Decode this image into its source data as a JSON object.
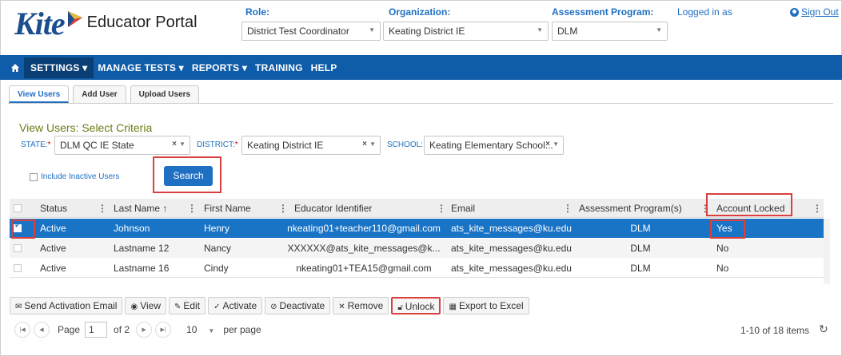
{
  "header": {
    "logo_word": "Kite",
    "portal_name": "Educator Portal",
    "role_label": "Role:",
    "role_value": "District Test Coordinator",
    "org_label": "Organization:",
    "org_value": "Keating District IE",
    "program_label": "Assessment Program:",
    "program_value": "DLM",
    "logged_in": "Logged in as",
    "sign_out": "Sign Out"
  },
  "nav": {
    "items": [
      "SETTINGS ▾",
      "MANAGE TESTS ▾",
      "REPORTS ▾",
      "TRAINING",
      "HELP"
    ]
  },
  "tabs": [
    "View Users",
    "Add User",
    "Upload Users"
  ],
  "criteria": {
    "title": "View Users: Select Criteria",
    "state_label": "STATE:",
    "state_value": "DLM QC IE State",
    "district_label": "DISTRICT:",
    "district_value": "Keating District IE",
    "school_label": "SCHOOL:",
    "school_value": "Keating Elementary School...",
    "required_mark": "*",
    "inactive_label": "Include Inactive Users",
    "search_button": "Search"
  },
  "grid": {
    "columns": [
      "Status",
      "Last Name ↑",
      "First Name",
      "Educator Identifier",
      "Email",
      "Assessment Program(s)",
      "Account Locked"
    ],
    "rows": [
      {
        "status": "Active",
        "last": "Johnson",
        "first": "Henry",
        "ident": "nkeating01+teacher110@gmail.com",
        "email": "ats_kite_messages@ku.edu",
        "program": "DLM",
        "locked": "Yes",
        "selected": true
      },
      {
        "status": "Active",
        "last": "Lastname 12",
        "first": "Nancy",
        "ident": "XXXXXX@ats_kite_messages@k...",
        "email": "ats_kite_messages@ku.edu",
        "program": "DLM",
        "locked": "No",
        "selected": false
      },
      {
        "status": "Active",
        "last": "Lastname 16",
        "first": "Cindy",
        "ident": "nkeating01+TEA15@gmail.com",
        "email": "ats_kite_messages@ku.edu",
        "program": "DLM",
        "locked": "No",
        "selected": false
      }
    ]
  },
  "toolbar": {
    "send_activation": "Send Activation Email",
    "view": "View",
    "edit": "Edit",
    "activate": "Activate",
    "deactivate": "Deactivate",
    "remove": "Remove",
    "unlock": "Unlock",
    "export": "Export to Excel"
  },
  "pager": {
    "page_label": "Page",
    "page_value": "1",
    "of_pages": "of 2",
    "page_size": "10",
    "per_page": "per page",
    "items_info": "1-10 of 18 items"
  },
  "colors": {
    "nav_bg": "#0f5ca8",
    "accent": "#1f6fc2",
    "selected_row": "#1a74c6",
    "highlight": "#d9403e",
    "criteria_title": "#6a7f17"
  }
}
